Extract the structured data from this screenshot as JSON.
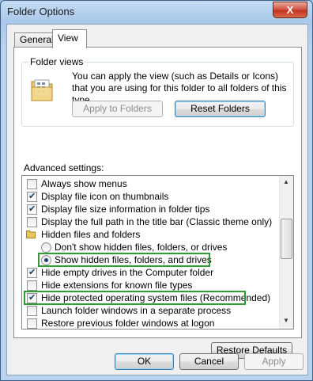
{
  "window": {
    "title": "Folder Options",
    "close_glyph": "X"
  },
  "tabs": [
    {
      "label": "General"
    },
    {
      "label": "View",
      "active": true
    }
  ],
  "folder_views": {
    "legend": "Folder views",
    "description": "You can apply the view (such as Details or Icons) that you are using for this folder to all folders of this type.",
    "apply_button": "Apply to Folders",
    "reset_button": "Reset Folders"
  },
  "advanced": {
    "label": "Advanced settings:",
    "items": [
      {
        "type": "checkbox",
        "checked": false,
        "label": "Always show menus"
      },
      {
        "type": "checkbox",
        "checked": true,
        "label": "Display file icon on thumbnails"
      },
      {
        "type": "checkbox",
        "checked": true,
        "label": "Display file size information in folder tips"
      },
      {
        "type": "checkbox",
        "checked": false,
        "label": "Display the full path in the title bar (Classic theme only)"
      },
      {
        "type": "folder",
        "label": "Hidden files and folders"
      },
      {
        "type": "radio",
        "checked": false,
        "label": "Don't show hidden files, folders, or drives"
      },
      {
        "type": "radio",
        "checked": true,
        "label": "Show hidden files, folders, and drives"
      },
      {
        "type": "checkbox",
        "checked": true,
        "label": "Hide empty drives in the Computer folder"
      },
      {
        "type": "checkbox",
        "checked": false,
        "label": "Hide extensions for known file types"
      },
      {
        "type": "checkbox",
        "checked": true,
        "label": "Hide protected operating system files (Recommended)"
      },
      {
        "type": "checkbox",
        "checked": false,
        "label": "Launch folder windows in a separate process"
      },
      {
        "type": "checkbox",
        "checked": false,
        "label": "Restore previous folder windows at logon"
      }
    ],
    "restore_button": "Restore Defaults"
  },
  "footer": {
    "ok": "OK",
    "cancel": "Cancel",
    "apply": "Apply"
  },
  "colors": {
    "highlight": "#2f9b3a",
    "check": "#1c3d73"
  }
}
